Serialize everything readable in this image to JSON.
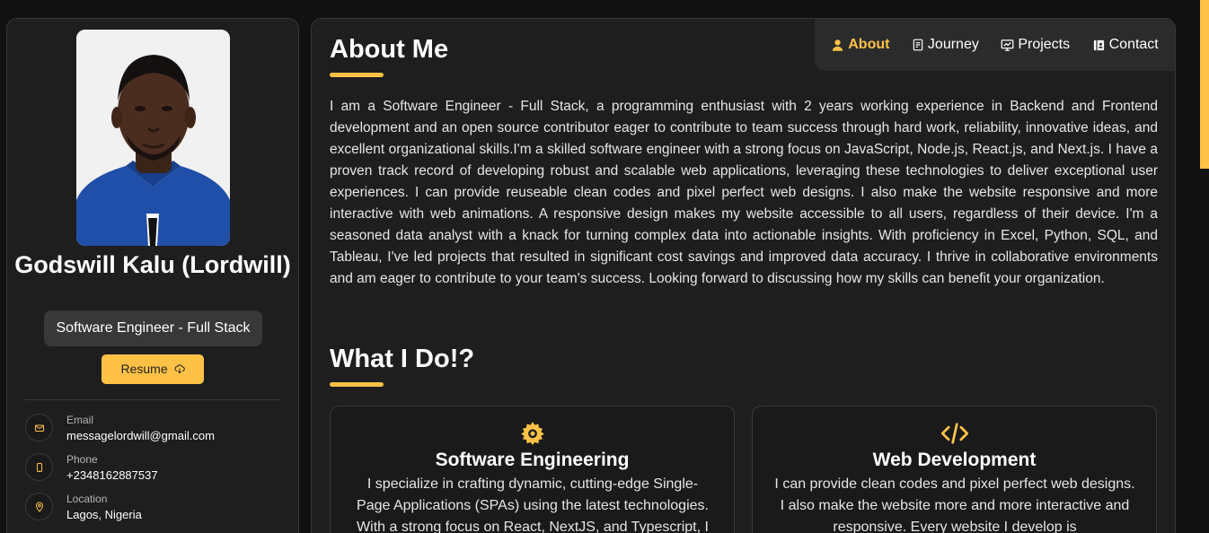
{
  "profile": {
    "name": "Godswill Kalu (Lordwill)",
    "title": "Software Engineer - Full Stack",
    "resume_label": "Resume"
  },
  "contacts": [
    {
      "icon": "mail-icon",
      "label": "Email",
      "value": "messagelordwill@gmail.com"
    },
    {
      "icon": "phone-icon",
      "label": "Phone",
      "value": "+2348162887537"
    },
    {
      "icon": "location-icon",
      "label": "Location",
      "value": "Lagos, Nigeria"
    }
  ],
  "nav": [
    {
      "label": "About",
      "icon": "user-icon",
      "active": true
    },
    {
      "label": "Journey",
      "icon": "document-icon",
      "active": false
    },
    {
      "label": "Projects",
      "icon": "presentation-icon",
      "active": false
    },
    {
      "label": "Contact",
      "icon": "contact-book-icon",
      "active": false
    }
  ],
  "about": {
    "heading": "About Me",
    "text": "I am a Software Engineer - Full Stack, a programming enthusiast with 2 years working experience in Backend and Frontend development and an open source contributor eager to contribute to team success through hard work, reliability, innovative ideas, and excellent organizational skills.I'm a skilled software engineer with a strong focus on JavaScript, Node.js, React.js, and Next.js. I have a proven track record of developing robust and scalable web applications, leveraging these technologies to deliver exceptional user experiences. I can provide reuseable clean codes and pixel perfect web designs. I also make the website responsive and more interactive with web animations. A responsive design makes my website accessible to all users, regardless of their device. I'm a seasoned data analyst with a knack for turning complex data into actionable insights. With proficiency in Excel, Python, SQL, and Tableau, I've led projects that resulted in significant cost savings and improved data accuracy. I thrive in collaborative environments and am eager to contribute to your team's success. Looking forward to discussing how my skills can benefit your organization."
  },
  "services": {
    "heading": "What I Do!?",
    "items": [
      {
        "icon": "gear-icon",
        "title": "Software Engineering",
        "text": "I specialize in crafting dynamic, cutting-edge Single-Page Applications (SPAs) using the latest technologies. With a strong focus on React, NextJS, and Typescript, I"
      },
      {
        "icon": "code-icon",
        "title": "Web Development",
        "text": "I can provide clean codes and pixel perfect web designs. I also make the website more and more interactive and responsive. Every website I develop is"
      }
    ]
  },
  "colors": {
    "accent": "#ffc247",
    "panel": "#1e1e1f",
    "background": "#111111"
  }
}
